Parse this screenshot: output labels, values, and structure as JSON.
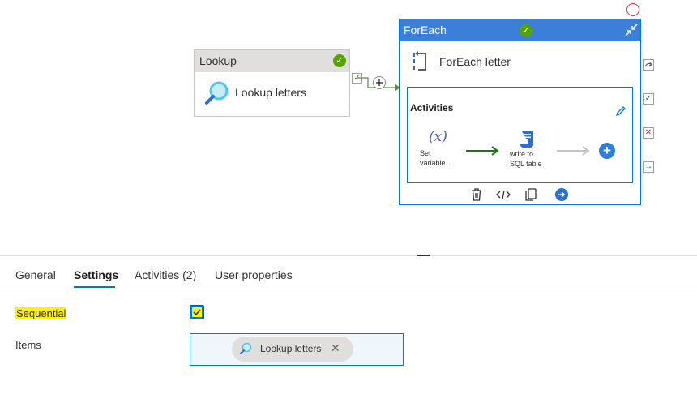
{
  "canvas": {
    "lookup": {
      "type_label": "Lookup",
      "name": "Lookup letters",
      "status": "success"
    },
    "foreach": {
      "type_label": "ForEach",
      "name": "ForEach letter",
      "status": "success",
      "inner": {
        "title": "Activities",
        "activity1": {
          "label_line1": "Set",
          "label_line2": "variable..."
        },
        "activity2": {
          "label_line1": "write to",
          "label_line2": "SQL table"
        }
      }
    },
    "colors": {
      "accent": "#0078d4",
      "foreach_header": "#3b7fd9",
      "success": "#57a300",
      "fail": "#d13438",
      "highlight": "#fff100"
    }
  },
  "tabs": [
    {
      "label": "General",
      "active": false
    },
    {
      "label": "Settings",
      "active": true
    },
    {
      "label": "Activities (2)",
      "active": false
    },
    {
      "label": "User properties",
      "active": false
    }
  ],
  "settings": {
    "sequential": {
      "label": "Sequential",
      "checked": true
    },
    "items": {
      "label": "Items",
      "chip": "Lookup letters"
    }
  },
  "icons": {
    "lookup": "magnifier-icon",
    "foreach": "foreach-icon",
    "set_variable": "variable-x-icon",
    "script": "script-icon",
    "toolbar": [
      "delete-icon",
      "code-icon",
      "copy-icon",
      "go-to-icon"
    ],
    "ports": [
      "skip-icon",
      "success-icon",
      "fail-icon",
      "complete-icon"
    ]
  }
}
